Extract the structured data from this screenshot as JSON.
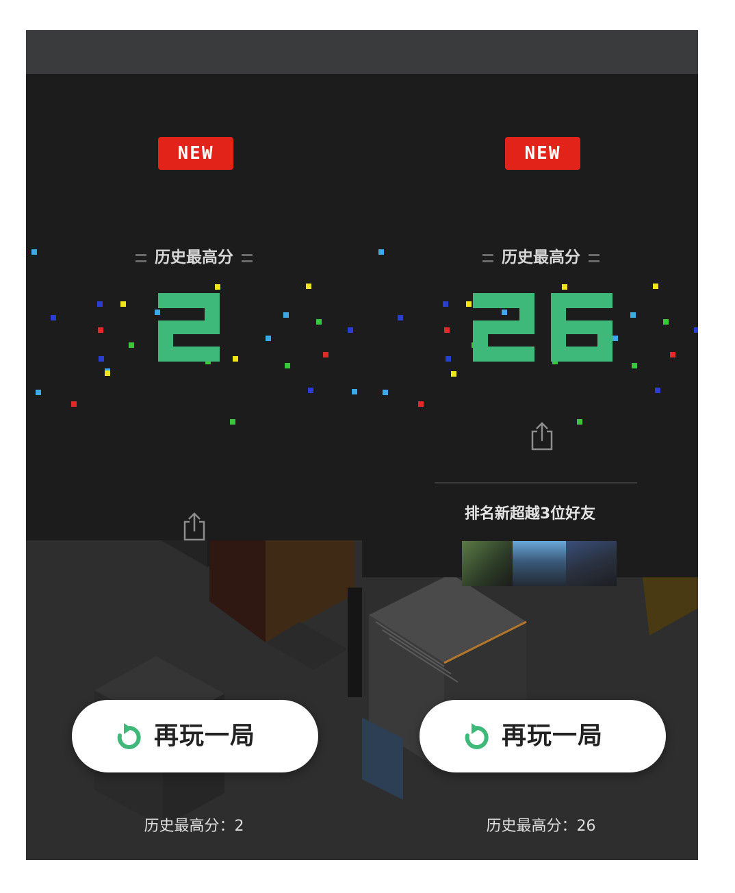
{
  "colors": {
    "badge": "#e2231a",
    "score": "#3fb97a",
    "replay_icon": "#3fb97a",
    "button_bg": "#ffffff"
  },
  "left": {
    "badge": "NEW",
    "high_score_title": "历史最高分",
    "score": "2",
    "replay_label": "再玩一局",
    "footer_label": "历史最高分：",
    "footer_value": "2",
    "share_icon": "share-icon",
    "replay_icon": "refresh-icon"
  },
  "right": {
    "badge": "NEW",
    "high_score_title": "历史最高分",
    "score": "26",
    "rank_text": "排名新超越3位好友",
    "replay_label": "再玩一局",
    "footer_label": "历史最高分：",
    "footer_value": "26",
    "share_icon": "share-icon",
    "replay_icon": "refresh-icon"
  }
}
